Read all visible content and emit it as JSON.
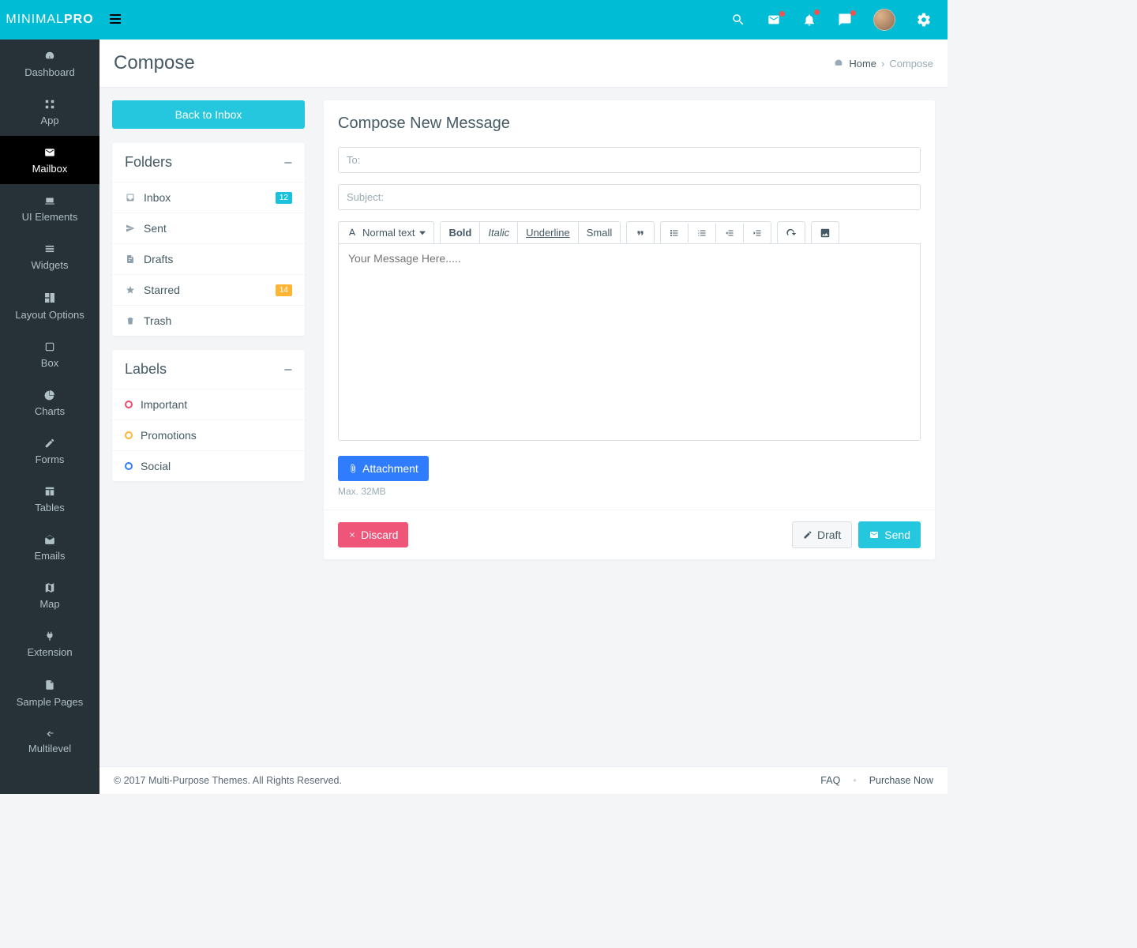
{
  "brand": {
    "base": "MINIMAL",
    "accent": "PRO"
  },
  "page": {
    "title": "Compose"
  },
  "breadcrumb": {
    "home": "Home",
    "current": "Compose"
  },
  "sidebar": {
    "items": [
      "Dashboard",
      "App",
      "Mailbox",
      "UI Elements",
      "Widgets",
      "Layout Options",
      "Box",
      "Charts",
      "Forms",
      "Tables",
      "Emails",
      "Map",
      "Extension",
      "Sample Pages",
      "Multilevel"
    ],
    "active": 2
  },
  "mail": {
    "back": "Back to Inbox",
    "foldersTitle": "Folders",
    "folders": [
      {
        "label": "Inbox",
        "badge": "12",
        "badgeStyle": "info"
      },
      {
        "label": "Sent"
      },
      {
        "label": "Drafts"
      },
      {
        "label": "Starred",
        "badge": "14",
        "badgeStyle": "warn"
      },
      {
        "label": "Trash"
      }
    ],
    "labelsTitle": "Labels",
    "labels": [
      {
        "label": "Important",
        "color": "#ef4d6e"
      },
      {
        "label": "Promotions",
        "color": "#ffb433"
      },
      {
        "label": "Social",
        "color": "#2f7cff"
      }
    ]
  },
  "compose": {
    "heading": "Compose New Message",
    "toPlaceholder": "To:",
    "subjectPlaceholder": "Subject:",
    "styleLabel": "Normal text",
    "bold": "Bold",
    "italic": "Italic",
    "underline": "Underline",
    "small": "Small",
    "bodyPlaceholder": "Your Message Here.....",
    "attach": "Attachment",
    "maxHint": "Max. 32MB",
    "discard": "Discard",
    "draft": "Draft",
    "send": "Send"
  },
  "footer": {
    "copyright": "© 2017 Multi-Purpose Themes. All Rights Reserved.",
    "faq": "FAQ",
    "purchase": "Purchase Now"
  }
}
